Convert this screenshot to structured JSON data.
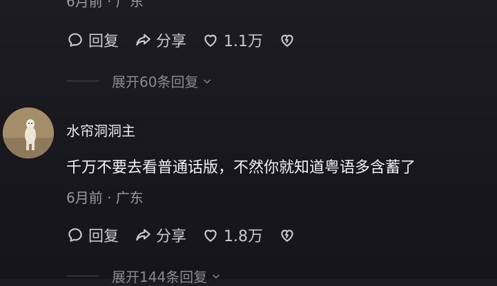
{
  "comments": [
    {
      "meta": "6月前 · 广东",
      "actions": {
        "reply": "回复",
        "share": "分享",
        "likes": "1.1万"
      },
      "expand": "展开60条回复"
    },
    {
      "username": "水帘洞洞主",
      "content": "千万不要去看普通话版，不然你就知道粤语多含蓄了",
      "meta": "6月前 · 广东",
      "actions": {
        "reply": "回复",
        "share": "分享",
        "likes": "1.8万"
      },
      "expand": "展开144条回复"
    }
  ]
}
